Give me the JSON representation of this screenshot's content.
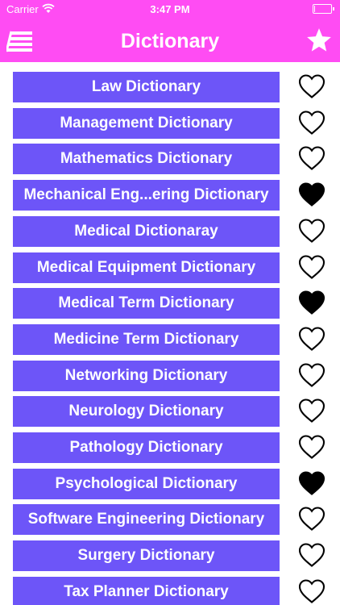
{
  "status": {
    "carrier": "Carrier",
    "time": "3:47 PM",
    "battery_level": 0.05
  },
  "header": {
    "title": "Dictionary",
    "left_icon": "menu-icon",
    "right_icon": "star-icon"
  },
  "colors": {
    "header_bg": "#ff4cf3",
    "item_bg": "#6d55f8",
    "item_text": "#ffffff"
  },
  "items": [
    {
      "label": "Law Dictionary",
      "favorite": false
    },
    {
      "label": "Management Dictionary",
      "favorite": false
    },
    {
      "label": "Mathematics Dictionary",
      "favorite": false
    },
    {
      "label": "Mechanical Eng...ering Dictionary",
      "favorite": true
    },
    {
      "label": "Medical Dictionaray",
      "favorite": false
    },
    {
      "label": "Medical Equipment Dictionary",
      "favorite": false
    },
    {
      "label": "Medical Term Dictionary",
      "favorite": true
    },
    {
      "label": "Medicine Term Dictionary",
      "favorite": false
    },
    {
      "label": "Networking Dictionary",
      "favorite": false
    },
    {
      "label": "Neurology Dictionary",
      "favorite": false
    },
    {
      "label": "Pathology Dictionary",
      "favorite": false
    },
    {
      "label": "Psychological Dictionary",
      "favorite": true
    },
    {
      "label": "Software Engineering Dictionary",
      "favorite": false
    },
    {
      "label": "Surgery Dictionary",
      "favorite": false
    },
    {
      "label": "Tax Planner Dictionary",
      "favorite": false
    }
  ]
}
